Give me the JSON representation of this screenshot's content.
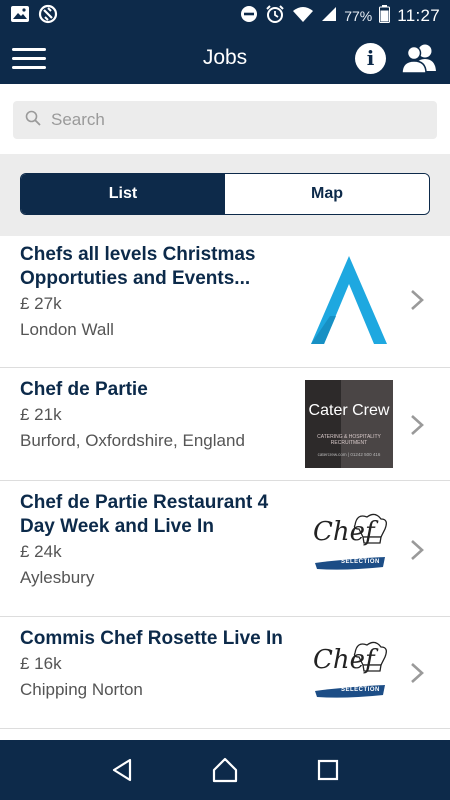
{
  "status_bar": {
    "battery_percent": "77%",
    "time": "11:27",
    "icons": [
      "image-icon",
      "no-sync-icon",
      "do-not-disturb-icon",
      "alarm-icon",
      "wifi-icon",
      "cellular-signal-icon",
      "battery-icon"
    ]
  },
  "app_bar": {
    "title": "Jobs",
    "icons": [
      "hamburger-menu-icon",
      "info-icon",
      "users-icon"
    ]
  },
  "search": {
    "placeholder": "Search"
  },
  "segments": {
    "list_label": "List",
    "map_label": "Map",
    "selected": "List"
  },
  "jobs": [
    {
      "title_line1": "Chefs all levels Christmas",
      "title_line2": "Opportuties and Events...",
      "salary": "£ 27k",
      "location": "London Wall",
      "logo": "blue-chevron-logo"
    },
    {
      "title_line1": "Chef de Partie",
      "title_line2": "",
      "salary": "£ 21k",
      "location": "Burford, Oxfordshire, England",
      "logo": "cater-crew-logo",
      "logo_text": "Cater Crew",
      "logo_tagline": "CATERING & HOSPITALITY RECRUITMENT",
      "logo_contact": "catercrew.com | 01242 500 416"
    },
    {
      "title_line1": "Chef de Partie Restaurant 4",
      "title_line2": "Day Week and Live In",
      "salary": "£ 24k",
      "location": "Aylesbury",
      "logo": "chef-selection-logo",
      "logo_text": "Chef",
      "logo_subtext": "SELECTION"
    },
    {
      "title_line1": "Commis Chef Rosette Live In",
      "title_line2": "",
      "salary": "£ 16k",
      "location": "Chipping Norton",
      "logo": "chef-selection-logo",
      "logo_text": "Chef",
      "logo_subtext": "SELECTION"
    }
  ],
  "colors": {
    "primary": "#0d2a4a",
    "accent_logo_blue": "#1ea8e0",
    "search_bg": "#ececec"
  },
  "nav_bar": {
    "icons": [
      "back-icon",
      "home-icon",
      "recents-icon"
    ]
  }
}
